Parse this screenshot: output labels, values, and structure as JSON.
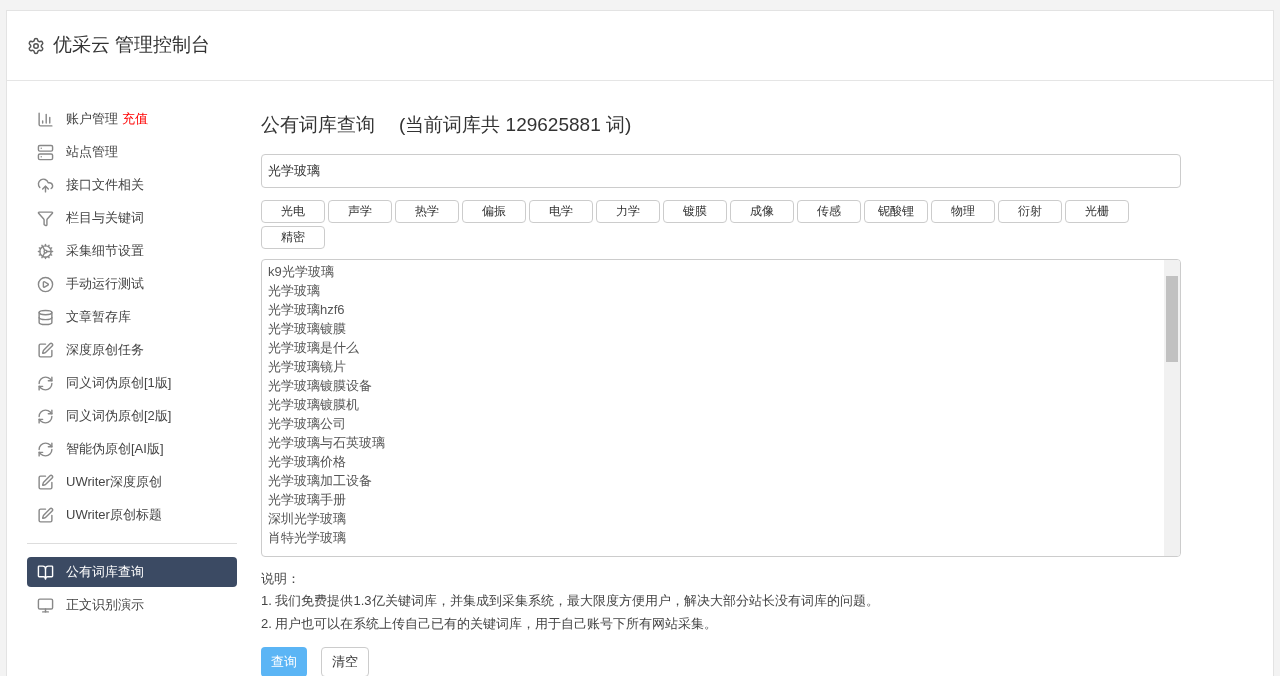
{
  "header": {
    "title": "优采云 管理控制台"
  },
  "sidebar": {
    "groups": [
      {
        "items": [
          {
            "label": "账户管理",
            "badge": "充值",
            "selected": false
          },
          {
            "label": "站点管理",
            "selected": false
          },
          {
            "label": "接口文件相关",
            "selected": false
          },
          {
            "label": "栏目与关键词",
            "selected": false
          },
          {
            "label": "采集细节设置",
            "selected": false
          },
          {
            "label": "手动运行测试",
            "selected": false
          },
          {
            "label": "文章暂存库",
            "selected": false
          },
          {
            "label": "深度原创任务",
            "selected": false
          },
          {
            "label": "同义词伪原创[1版]",
            "selected": false
          },
          {
            "label": "同义词伪原创[2版]",
            "selected": false
          },
          {
            "label": "智能伪原创[AI版]",
            "selected": false
          },
          {
            "label": "UWriter深度原创",
            "selected": false
          },
          {
            "label": "UWriter原创标题",
            "selected": false
          }
        ]
      },
      {
        "items": [
          {
            "label": "公有词库查询",
            "selected": true
          },
          {
            "label": "正文识别演示",
            "selected": false
          }
        ]
      }
    ]
  },
  "main": {
    "title": "公有词库查询",
    "subtitle": "(当前词库共 129625881 词)",
    "search": {
      "value": "光学玻璃"
    },
    "tags": [
      "光电",
      "声学",
      "热学",
      "偏振",
      "电学",
      "力学",
      "镀膜",
      "成像",
      "传感",
      "铌酸锂",
      "物理",
      "衍射",
      "光栅",
      "精密"
    ],
    "results": [
      "k9光学玻璃",
      "光学玻璃",
      "光学玻璃hzf6",
      "光学玻璃镀膜",
      "光学玻璃是什么",
      "光学玻璃镜片",
      "光学玻璃镀膜设备",
      "光学玻璃镀膜机",
      "光学玻璃公司",
      "光学玻璃与石英玻璃",
      "光学玻璃价格",
      "光学玻璃加工设备",
      "光学玻璃手册",
      "深圳光学玻璃",
      "肖特光学玻璃"
    ],
    "notes_title": "说明：",
    "notes": [
      "1. 我们免费提供1.3亿关键词库，并集成到采集系统，最大限度方便用户，解决大部分站长没有词库的问题。",
      "2. 用户也可以在系统上传自己已有的关键词库，用于自己账号下所有网站采集。"
    ],
    "buttons": [
      {
        "label": "查询",
        "kind": "primary"
      },
      {
        "label": "清空",
        "kind": "default"
      }
    ]
  }
}
